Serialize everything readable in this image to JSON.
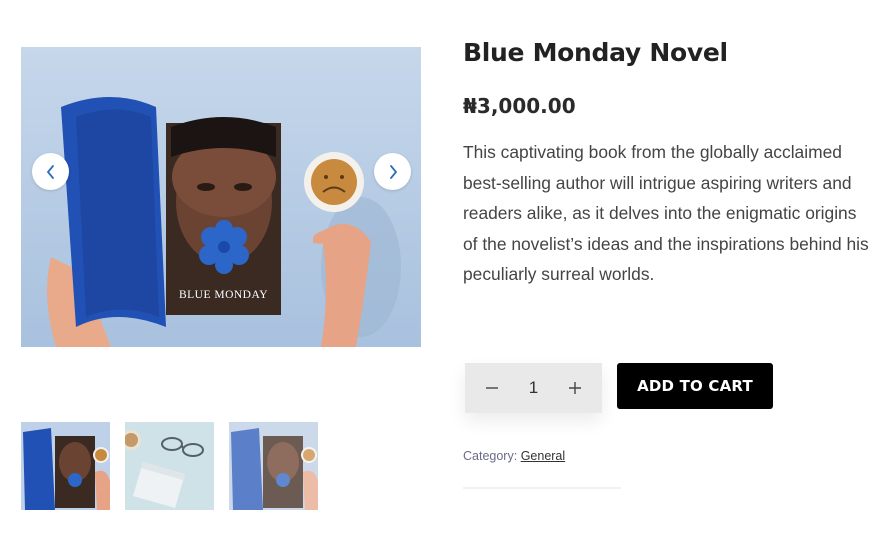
{
  "product": {
    "title": "Blue Monday Novel",
    "price": "₦3,000.00",
    "description": "This captivating book from the globally acclaimed best-selling author will intrigue aspiring writers and readers alike, as it delves into the enigmatic origins of the novelist’s ideas and the inspirations behind his peculiarly surreal worlds.",
    "book_cover_text": "BLUE MONDAY"
  },
  "gallery": {
    "thumbnails": [
      "book-cover-image",
      "coffee-glasses-image",
      "book-cover-image-faded"
    ],
    "icons": {
      "prev": "chevron-left-icon",
      "next": "chevron-right-icon"
    }
  },
  "cart": {
    "quantity": "1",
    "add_label": "ADD TO CART"
  },
  "meta": {
    "category_label": "Category:",
    "category_value": "General"
  },
  "colors": {
    "accent": "#000000",
    "book_blue": "#2251b5",
    "background_blue": "#b9cee6",
    "arrow_blue": "#2c6fb5"
  }
}
